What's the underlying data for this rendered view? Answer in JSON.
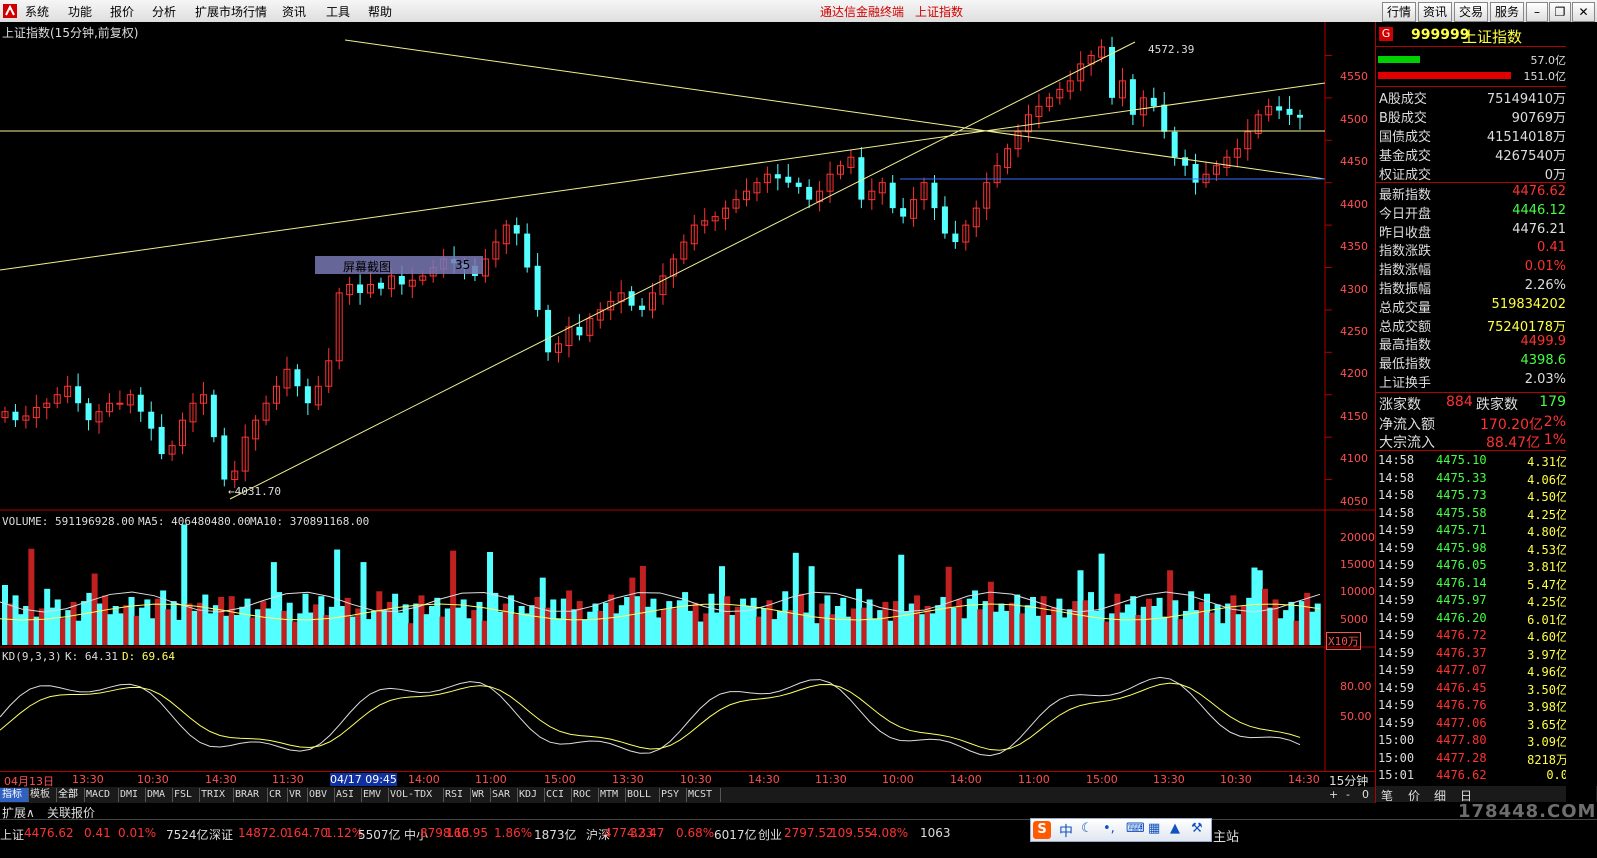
{
  "menubar": {
    "items": [
      "系统",
      "功能",
      "报价",
      "分析",
      "扩展市场行情",
      "资讯",
      "工具",
      "帮助"
    ],
    "title_left": "通达信金融终端",
    "title_right": "上证指数",
    "right_buttons": [
      "行情",
      "资讯",
      "交易",
      "服务"
    ]
  },
  "chart": {
    "title": "上证指数(15分钟,前复权)",
    "popup_label": "屏幕截图",
    "popup_value": "35",
    "high_mark": "4572.39",
    "low_mark": "4031.70",
    "price_ticks": [
      "4550",
      "4500",
      "4450",
      "4400",
      "4350",
      "4300",
      "4250",
      "4200",
      "4150",
      "4100",
      "4050"
    ],
    "volume_label": "VOLUME: 591196928.00",
    "ma5_label": "MA5: 406480480.00",
    "ma10_label": "MA10: 370891168.00",
    "volume_ticks": [
      "20000",
      "15000",
      "10000",
      "5000"
    ],
    "volume_unit": "X10万",
    "kd_label": "KD(9,3,3)",
    "k_label": "K: 64.31",
    "d_label": "D: 69.64",
    "kd_ticks": [
      "80.00",
      "50.00"
    ],
    "time_ticks": [
      "04月13日",
      "13:30",
      "10:30",
      "14:30",
      "11:30",
      "04/17 09:45",
      "14:00",
      "11:00",
      "15:00",
      "13:30",
      "10:30",
      "14:30",
      "11:30",
      "10:00",
      "14:00",
      "11:00",
      "15:00",
      "13:30",
      "10:30",
      "14:30"
    ],
    "period": "15分钟",
    "colors": {
      "up": "#ff3232",
      "down": "#54ffff",
      "trendline": "#f0f090",
      "hline": "#3a6cff"
    }
  },
  "chart_data": {
    "type": "candlestick",
    "title": "上证指数(15分钟,前复权)",
    "ylim": [
      4020,
      4580
    ],
    "high": 4572.39,
    "low": 4031.7,
    "closes": [
      4130,
      4120,
      4125,
      4135,
      4140,
      4150,
      4160,
      4140,
      4120,
      4130,
      4140,
      4140,
      4150,
      4130,
      4110,
      4080,
      4090,
      4120,
      4140,
      4150,
      4100,
      4050,
      4060,
      4100,
      4120,
      4140,
      4160,
      4180,
      4160,
      4140,
      4160,
      4190,
      4270,
      4280,
      4270,
      4280,
      4275,
      4290,
      4280,
      4285,
      4290,
      4300,
      4310,
      4305,
      4300,
      4290,
      4310,
      4330,
      4350,
      4340,
      4300,
      4250,
      4200,
      4210,
      4230,
      4220,
      4240,
      4250,
      4260,
      4270,
      4255,
      4250,
      4270,
      4290,
      4310,
      4330,
      4350,
      4355,
      4360,
      4370,
      4380,
      4390,
      4400,
      4410,
      4405,
      4400,
      4395,
      4380,
      4390,
      4410,
      4420,
      4430,
      4380,
      4390,
      4400,
      4370,
      4360,
      4380,
      4400,
      4370,
      4340,
      4330,
      4350,
      4370,
      4400,
      4420,
      4440,
      4460,
      4480,
      4490,
      4500,
      4510,
      4520,
      4540,
      4550,
      4560,
      4500,
      4520,
      4480,
      4500,
      4490,
      4460,
      4430,
      4420,
      4400,
      4410,
      4420,
      4430,
      4440,
      4460,
      4480,
      4490,
      4485,
      4480,
      4476.62
    ],
    "volume": {
      "last": 591196928.0,
      "ma5": 406480480.0,
      "ma10": 370891168.0,
      "ylim": [
        0,
        22000
      ]
    },
    "kd": {
      "k": 64.31,
      "d": 69.64
    }
  },
  "panel": {
    "code": "999999",
    "name": "上证指数",
    "bar1_val": "57.0亿",
    "bar2_val": "151.0亿",
    "bar1_frac": 0.35,
    "bar2_frac": 0.95,
    "stats_a": [
      {
        "k": "A股成交",
        "v": "75149410万",
        "c": "#ddd"
      },
      {
        "k": "B股成交",
        "v": "90769万",
        "c": "#ddd"
      },
      {
        "k": "国债成交",
        "v": "41514018万",
        "c": "#ddd"
      },
      {
        "k": "基金成交",
        "v": "4267540万",
        "c": "#ddd"
      },
      {
        "k": "权证成交",
        "v": "0万",
        "c": "#ddd"
      }
    ],
    "stats_b": [
      {
        "k": "最新指数",
        "v": "4476.62",
        "c": "#ff3232"
      },
      {
        "k": "今日开盘",
        "v": "4446.12",
        "c": "#44ff44"
      },
      {
        "k": "昨日收盘",
        "v": "4476.21",
        "c": "#ddd"
      },
      {
        "k": "指数涨跌",
        "v": "0.41",
        "c": "#ff3232"
      },
      {
        "k": "指数涨幅",
        "v": "0.01%",
        "c": "#ff3232"
      },
      {
        "k": "指数振幅",
        "v": "2.26%",
        "c": "#ddd"
      },
      {
        "k": "总成交量",
        "v": "519834202",
        "c": "#ffff44"
      },
      {
        "k": "总成交额",
        "v": "75240178万",
        "c": "#ffff44"
      },
      {
        "k": "最高指数",
        "v": "4499.9",
        "c": "#ff3232"
      },
      {
        "k": "最低指数",
        "v": "4398.6",
        "c": "#44ff44"
      },
      {
        "k": "上证换手",
        "v": "2.03%",
        "c": "#ddd"
      }
    ],
    "up_label": "涨家数",
    "up_val": "884",
    "down_label": "跌家数",
    "down_val": "179",
    "netflow_label": "净流入额",
    "netflow_val": "170.20亿",
    "netflow_pct": "2%",
    "block_label": "大宗流入",
    "block_val": "88.47亿",
    "block_pct": "1%",
    "ticks": [
      {
        "t": "14:58",
        "p": "4475.10",
        "a": "4.31亿",
        "c": "#44ff44"
      },
      {
        "t": "14:58",
        "p": "4475.33",
        "a": "4.06亿",
        "c": "#44ff44"
      },
      {
        "t": "14:58",
        "p": "4475.73",
        "a": "4.50亿",
        "c": "#44ff44"
      },
      {
        "t": "14:58",
        "p": "4475.58",
        "a": "4.25亿",
        "c": "#44ff44"
      },
      {
        "t": "14:59",
        "p": "4475.71",
        "a": "4.80亿",
        "c": "#44ff44"
      },
      {
        "t": "14:59",
        "p": "4475.98",
        "a": "4.53亿",
        "c": "#44ff44"
      },
      {
        "t": "14:59",
        "p": "4476.05",
        "a": "3.81亿",
        "c": "#44ff44"
      },
      {
        "t": "14:59",
        "p": "4476.14",
        "a": "5.47亿",
        "c": "#44ff44"
      },
      {
        "t": "14:59",
        "p": "4475.97",
        "a": "4.25亿",
        "c": "#44ff44"
      },
      {
        "t": "14:59",
        "p": "4476.20",
        "a": "6.01亿",
        "c": "#44ff44"
      },
      {
        "t": "14:59",
        "p": "4476.72",
        "a": "4.60亿",
        "c": "#ff3232"
      },
      {
        "t": "14:59",
        "p": "4476.37",
        "a": "3.97亿",
        "c": "#ff3232"
      },
      {
        "t": "14:59",
        "p": "4477.07",
        "a": "4.96亿",
        "c": "#ff3232"
      },
      {
        "t": "14:59",
        "p": "4476.45",
        "a": "3.50亿",
        "c": "#ff3232"
      },
      {
        "t": "14:59",
        "p": "4476.76",
        "a": "3.98亿",
        "c": "#ff3232"
      },
      {
        "t": "14:59",
        "p": "4477.06",
        "a": "3.65亿",
        "c": "#ff3232"
      },
      {
        "t": "15:00",
        "p": "4477.80",
        "a": "3.09亿",
        "c": "#ff3232"
      },
      {
        "t": "15:00",
        "p": "4477.28",
        "a": "8218万",
        "c": "#ff3232"
      },
      {
        "t": "15:01",
        "p": "4476.62",
        "a": "0.0",
        "c": "#ff3232"
      }
    ],
    "bottom_tabs": [
      "笔",
      "价",
      "细",
      "日"
    ]
  },
  "indicator_tabs": [
    "指标",
    "模板",
    "全部",
    "MACD",
    "DMI",
    "DMA",
    "FSL",
    "TRIX",
    "BRAR",
    "CR",
    "VR",
    "OBV",
    "ASI",
    "EMV",
    "VOL-TDX",
    "RSI",
    "WR",
    "SAR",
    "KDJ",
    "CCI",
    "ROC",
    "MTM",
    "BOLL",
    "PSY",
    "MCST"
  ],
  "sub_tabs": [
    "扩展∧",
    "关联报价"
  ],
  "status": {
    "items": [
      {
        "t": "上证",
        "c": "#ddd"
      },
      {
        "t": "4476.62",
        "c": "#ff3232"
      },
      {
        "t": "0.41",
        "c": "#ff3232"
      },
      {
        "t": "0.01%",
        "c": "#ff3232"
      },
      {
        "t": "7524亿",
        "c": "#ddd"
      },
      {
        "t": "深证",
        "c": "#ddd"
      },
      {
        "t": "14872.0",
        "c": "#ff3232"
      },
      {
        "t": "164.70",
        "c": "#ff3232"
      },
      {
        "t": "1.12%",
        "c": "#ff3232"
      },
      {
        "t": "5507亿",
        "c": "#ddd"
      },
      {
        "t": "中小",
        "c": "#ddd"
      },
      {
        "t": "8798.15",
        "c": "#ff3232"
      },
      {
        "t": "160.95",
        "c": "#ff3232"
      },
      {
        "t": "1.86%",
        "c": "#ff3232"
      },
      {
        "t": "1873亿",
        "c": "#ddd"
      },
      {
        "t": "沪深",
        "c": "#ddd"
      },
      {
        "t": "4774.33",
        "c": "#ff3232"
      },
      {
        "t": "32.47",
        "c": "#ff3232"
      },
      {
        "t": "0.68%",
        "c": "#ff3232"
      },
      {
        "t": "6017亿",
        "c": "#ddd"
      },
      {
        "t": "创业",
        "c": "#ddd"
      },
      {
        "t": "2797.52",
        "c": "#ff3232"
      },
      {
        "t": "109.55",
        "c": "#ff3232"
      },
      {
        "t": "4.08%",
        "c": "#ff3232"
      },
      {
        "t": "1063",
        "c": "#ddd"
      }
    ],
    "ime": "中",
    "main_site": "主站",
    "watermark": "178448.COM"
  }
}
